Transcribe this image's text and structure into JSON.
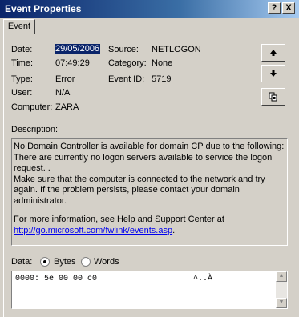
{
  "window": {
    "title": "Event Properties",
    "help_button": "?",
    "close_button": "X"
  },
  "tabs": [
    {
      "label": "Event"
    }
  ],
  "fields": {
    "date_label": "Date:",
    "date_value": "29/05/2006",
    "time_label": "Time:",
    "time_value": "07:49:29",
    "type_label": "Type:",
    "type_value": "Error",
    "user_label": "User:",
    "user_value": "N/A",
    "computer_label": "Computer:",
    "computer_value": "ZARA",
    "source_label": "Source:",
    "source_value": "NETLOGON",
    "category_label": "Category:",
    "category_value": "None",
    "eventid_label": "Event ID:",
    "eventid_value": "5719"
  },
  "nav": {
    "up_icon": "arrow-up",
    "down_icon": "arrow-down",
    "copy_icon": "copy"
  },
  "description": {
    "label": "Description:",
    "line1": "No Domain Controller is available for domain CP due to the following:",
    "line2": "There are currently no logon servers available to service the logon request. .",
    "line3": "Make sure that the computer is connected to the network and try again. If the problem persists, please contact your domain administrator.",
    "line4": "For more information, see Help and Support Center at",
    "link": "http://go.microsoft.com/fwlink/events.asp",
    "link_suffix": "."
  },
  "data": {
    "label": "Data:",
    "bytes_label": "Bytes",
    "words_label": "Words",
    "selected": "Bytes",
    "hex_line": "0000: 5e 00 00 c0",
    "ascii_line": "^..À"
  }
}
